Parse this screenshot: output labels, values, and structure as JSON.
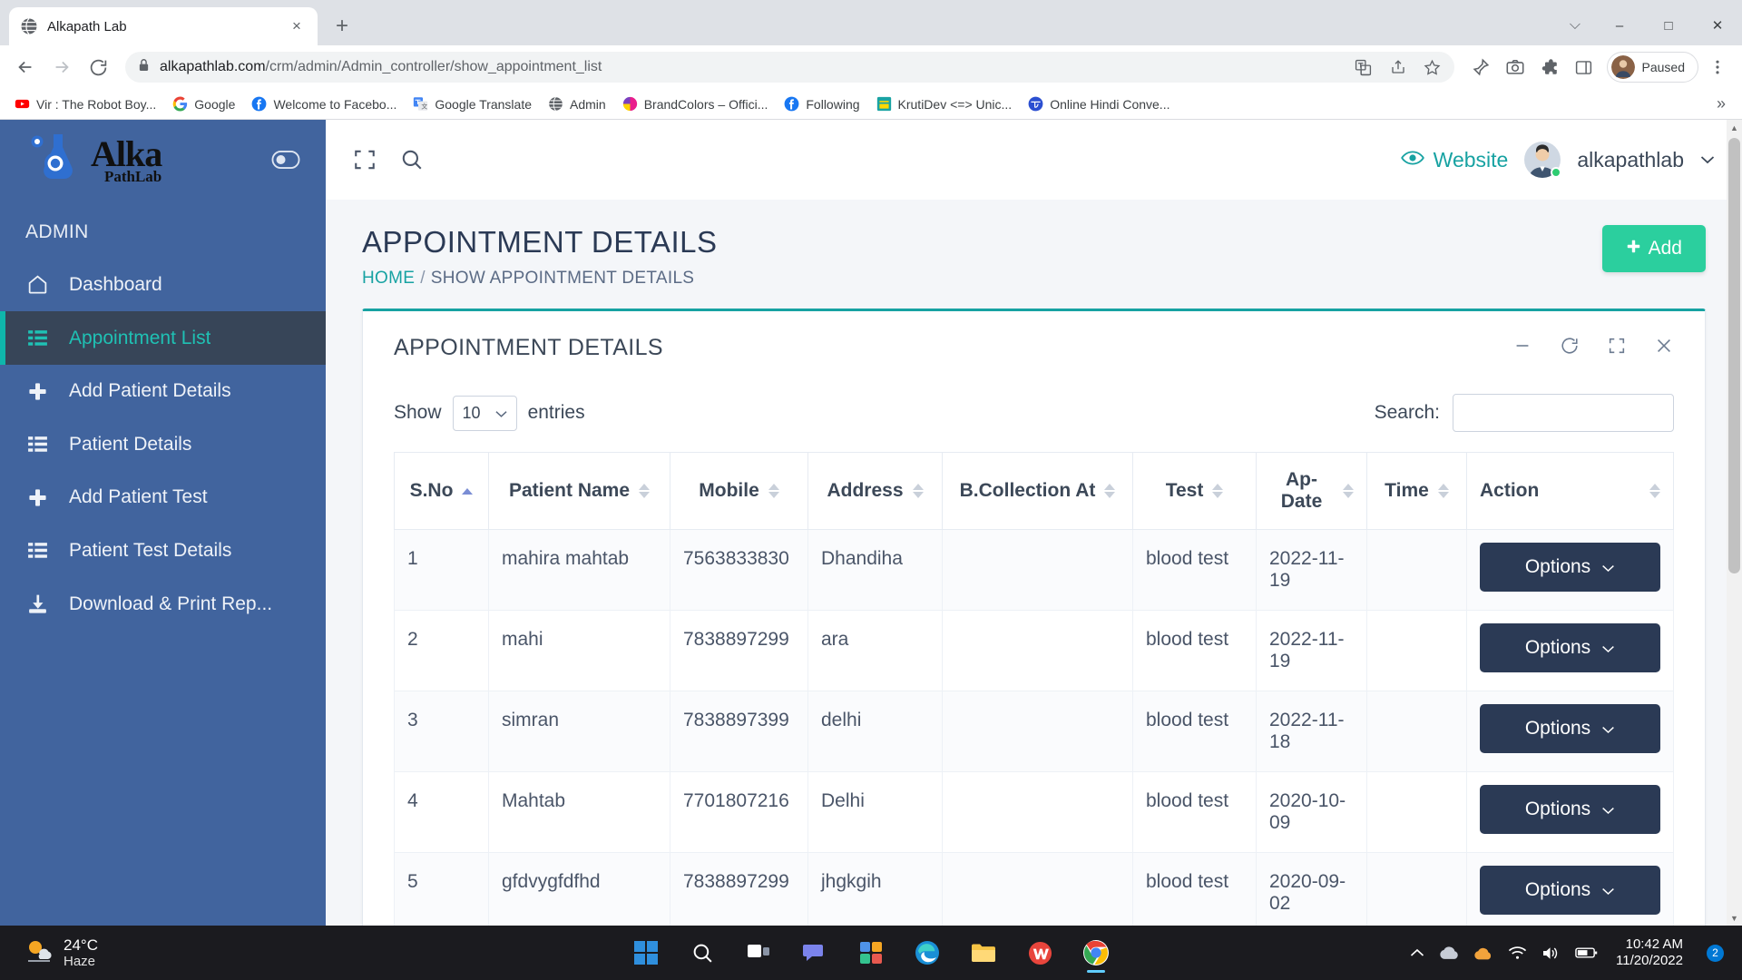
{
  "browser": {
    "tab": {
      "title": "Alkapath Lab",
      "favicon": "globe-icon",
      "close": "×"
    },
    "newtab_label": "+",
    "window_controls": {
      "minimize": "–",
      "maximize": "□",
      "close": "✕",
      "chevron": "⌵"
    },
    "omnibox": {
      "url_host": "alkapathlab.com",
      "url_path": "/crm/admin/Admin_controller/show_appointment_list",
      "lock": "lock-icon"
    },
    "profile": {
      "label": "Paused"
    },
    "bookmarks": [
      {
        "label": "Vir : The Robot Boy...",
        "icon": "youtube-icon"
      },
      {
        "label": "Google",
        "icon": "google-icon"
      },
      {
        "label": "Welcome to Facebo...",
        "icon": "facebook-icon"
      },
      {
        "label": "Google Translate",
        "icon": "google-translate-icon"
      },
      {
        "label": "Admin",
        "icon": "globe-icon"
      },
      {
        "label": "BrandColors – Offici...",
        "icon": "brandcolors-icon"
      },
      {
        "label": "Following",
        "icon": "facebook-icon"
      },
      {
        "label": "KrutiDev <=> Unic...",
        "icon": "krutidev-icon"
      },
      {
        "label": "Online Hindi Conve...",
        "icon": "hindi-converter-icon"
      }
    ],
    "bookmarks_overflow": "»"
  },
  "sidebar": {
    "logo_main": "Alka",
    "logo_sub": "PathLab",
    "section_label": "ADMIN",
    "items": [
      {
        "label": "Dashboard",
        "icon": "home-icon",
        "active": false
      },
      {
        "label": "Appointment List",
        "icon": "list-icon",
        "active": true
      },
      {
        "label": "Add Patient Details",
        "icon": "plus-icon",
        "active": false
      },
      {
        "label": "Patient Details",
        "icon": "list-icon",
        "active": false
      },
      {
        "label": "Add Patient Test",
        "icon": "plus-icon",
        "active": false
      },
      {
        "label": "Patient Test Details",
        "icon": "list-icon",
        "active": false
      },
      {
        "label": "Download & Print Rep...",
        "icon": "download-icon",
        "active": false
      }
    ]
  },
  "topbar": {
    "fullscreen_icon": "expand-icon",
    "search_icon": "search-icon",
    "website_label": "Website",
    "website_icon": "eye-icon",
    "user_name": "alkapathlab",
    "user_caret": "⌄"
  },
  "page": {
    "title": "APPOINTMENT DETAILS",
    "breadcrumb": {
      "home": "HOME",
      "separator": "/",
      "current": "SHOW APPOINTMENT DETAILS"
    },
    "add_button": {
      "label": "Add",
      "icon": "plus-icon",
      "color": "#2bcf9e"
    }
  },
  "card": {
    "title": "APPOINTMENT DETAILS",
    "tools": [
      {
        "name": "minimize-icon",
        "glyph": "–"
      },
      {
        "name": "refresh-icon",
        "glyph": "⟳"
      },
      {
        "name": "expand-icon",
        "glyph": "⛶"
      },
      {
        "name": "close-icon",
        "glyph": "✕"
      }
    ]
  },
  "table_controls": {
    "show_label": "Show",
    "entries_value": "10",
    "entries_label": "entries",
    "search_label": "Search:",
    "search_value": "",
    "search_placeholder": ""
  },
  "table": {
    "columns": [
      {
        "label": "S.No",
        "sorted": "asc"
      },
      {
        "label": "Patient Name",
        "sorted": "none"
      },
      {
        "label": "Mobile",
        "sorted": "none"
      },
      {
        "label": "Address",
        "sorted": "none"
      },
      {
        "label": "B.Collection At",
        "sorted": "none"
      },
      {
        "label": "Test",
        "sorted": "none"
      },
      {
        "label": "Ap-Date",
        "sorted": "none"
      },
      {
        "label": "Time",
        "sorted": "none"
      },
      {
        "label": "Action",
        "sorted": "none"
      }
    ],
    "rows": [
      {
        "sno": "1",
        "name": "mahira mahtab",
        "mobile": "7563833830",
        "address": "Dhandiha",
        "collection_at": "",
        "test": "blood test",
        "ap_date": "2022-11-19",
        "time": "",
        "action": "Options"
      },
      {
        "sno": "2",
        "name": "mahi",
        "mobile": "7838897299",
        "address": "ara",
        "collection_at": "",
        "test": "blood test",
        "ap_date": "2022-11-19",
        "time": "",
        "action": "Options"
      },
      {
        "sno": "3",
        "name": "simran",
        "mobile": "7838897399",
        "address": "delhi",
        "collection_at": "",
        "test": "blood test",
        "ap_date": "2022-11-18",
        "time": "",
        "action": "Options"
      },
      {
        "sno": "4",
        "name": "Mahtab",
        "mobile": "7701807216",
        "address": "Delhi",
        "collection_at": "",
        "test": "blood test",
        "ap_date": "2020-10-09",
        "time": "",
        "action": "Options"
      },
      {
        "sno": "5",
        "name": "gfdvygfdfhd",
        "mobile": "7838897299",
        "address": "jhgkgih",
        "collection_at": "",
        "test": "blood test",
        "ap_date": "2020-09-02",
        "time": "",
        "action": "Options"
      }
    ],
    "options_caret": "⌄"
  },
  "taskbar": {
    "weather": {
      "temp": "24°C",
      "condition": "Haze",
      "icon": "haze-icon"
    },
    "apps": [
      {
        "name": "start-icon"
      },
      {
        "name": "search-icon"
      },
      {
        "name": "task-view-icon"
      },
      {
        "name": "chat-icon"
      },
      {
        "name": "widgets-icon"
      },
      {
        "name": "edge-icon"
      },
      {
        "name": "file-explorer-icon"
      },
      {
        "name": "wps-office-icon"
      },
      {
        "name": "chrome-icon"
      }
    ],
    "tray": {
      "chevron": "⌃",
      "cloud_icon": "cloud-icon",
      "onedrive_icon": "onedrive-icon",
      "wifi_icon": "wifi-icon",
      "volume_icon": "volume-icon",
      "battery_icon": "battery-icon",
      "time": "10:42 AM",
      "date": "11/20/2022",
      "notification_count": "2"
    }
  }
}
